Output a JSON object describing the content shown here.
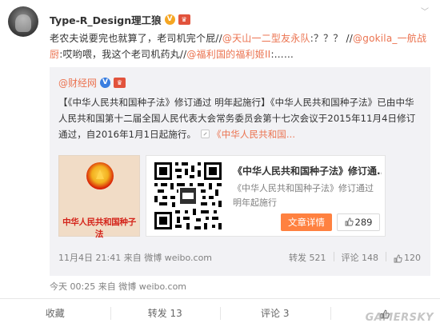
{
  "post": {
    "username": "Type-R_Design理工狼",
    "verified_badge": "V",
    "medal_badge": "♛",
    "menu_icon": "chevron-down-icon",
    "content": {
      "p1": "老农夫说要完也就算了，老司机完个屁//",
      "m1": "@天山一二型友永队",
      "p2": ":？？？ //",
      "m2": "@gokila_一航战厨",
      "p3": ":哎哟喂，我这个老司机药丸//",
      "m3": "@福利国的福利姬II",
      "p4": ":……"
    },
    "time": "今天 00:25",
    "source": "来自 微博 weibo.com"
  },
  "quoted": {
    "author": "@财经网",
    "verified_badge": "V",
    "medal_badge": "♛",
    "text": "【《中华人民共和国种子法》修订通过 明年起施行】《中华人民共和国种子法》已由中华人民共和国第十二届全国人民代表大会常务委员会第十七次会议于2015年11月4日修订通过，自2016年1月1日起施行。",
    "link_label": "《中华人民共和国...",
    "thumbnail_title": "中华人民共和国种子法",
    "card": {
      "title": "《中华人民共和国种子法》修订通...",
      "desc": "《中华人民共和国种子法》修订通过 明年起施行",
      "detail_button": "文章详情",
      "like_count": "289"
    },
    "time": "11月4日 21:41",
    "source": "来自 微博 weibo.com",
    "repost_label": "转发 521",
    "comment_label": "评论 148",
    "like_count": "120"
  },
  "actions": {
    "favorite": "收藏",
    "repost": "转发 13",
    "comment": "评论 3"
  },
  "watermark": "GAMERSKY",
  "colors": {
    "accent_link": "#eb7350",
    "detail_button": "#ff8140",
    "quote_bg": "#f2f2f5",
    "meta_text": "#808080"
  }
}
